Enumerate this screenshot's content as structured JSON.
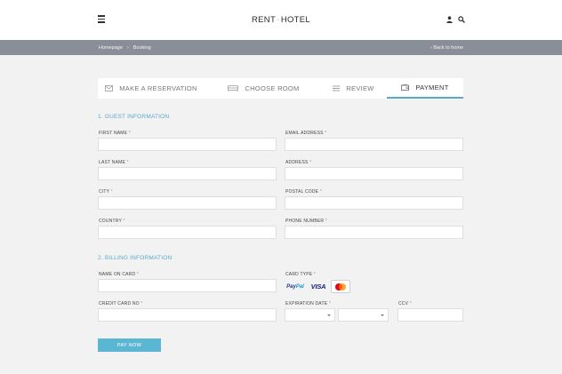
{
  "header": {
    "logo_left": "RENT",
    "logo_right": "HOTEL",
    "icons": [
      "menu-icon",
      "user-icon",
      "search-icon"
    ]
  },
  "breadcrumb": {
    "items": [
      "Homepage",
      "Booking"
    ],
    "separator": "›",
    "back_label": "‹ Back to home"
  },
  "steps": [
    {
      "label": "MAKE A RESERVATION",
      "icon": "envelope-icon",
      "active": false
    },
    {
      "label": "CHOOSE ROOM",
      "icon": "bed-icon",
      "active": false
    },
    {
      "label": "REVIEW",
      "icon": "list-icon",
      "active": false
    },
    {
      "label": "PAYMENT",
      "icon": "wallet-icon",
      "active": true
    }
  ],
  "guest_section": {
    "title": "1. GUEST INFORMATION",
    "fields": {
      "first_name": {
        "label": "FIRST NAME",
        "value": ""
      },
      "email": {
        "label": "EMAIL ADDRESS",
        "value": ""
      },
      "last_name": {
        "label": "LAST NAME",
        "value": ""
      },
      "address": {
        "label": "ADDRESS",
        "value": ""
      },
      "city": {
        "label": "CITY",
        "value": ""
      },
      "postal_code": {
        "label": "POSTAL CODE",
        "value": ""
      },
      "country": {
        "label": "COUNTRY",
        "value": ""
      },
      "phone": {
        "label": "PHONE NUMBER",
        "value": ""
      }
    }
  },
  "billing_section": {
    "title": "2. BILLING INFORMATION",
    "fields": {
      "name_on_card": {
        "label": "NAME ON CARD",
        "value": ""
      },
      "card_type": {
        "label": "CARD TYPE"
      },
      "card_no": {
        "label": "CREDIT CARD NO",
        "value": ""
      },
      "expiration": {
        "label": "EXPIRATION DATE",
        "month": "",
        "year": ""
      },
      "ccv": {
        "label": "CCV",
        "value": ""
      }
    },
    "card_types": {
      "paypal_a": "Pay",
      "paypal_b": "Pal",
      "visa": "VISA",
      "mastercard": "mastercard-logo",
      "selected": "mastercard"
    }
  },
  "required_mark": "*",
  "pay_button": "PAY NOW",
  "colors": {
    "accent": "#5aa9c9",
    "button": "#5bb6d4",
    "breadcrumb_bar": "#8a8e99",
    "background": "#f2f2f2"
  }
}
